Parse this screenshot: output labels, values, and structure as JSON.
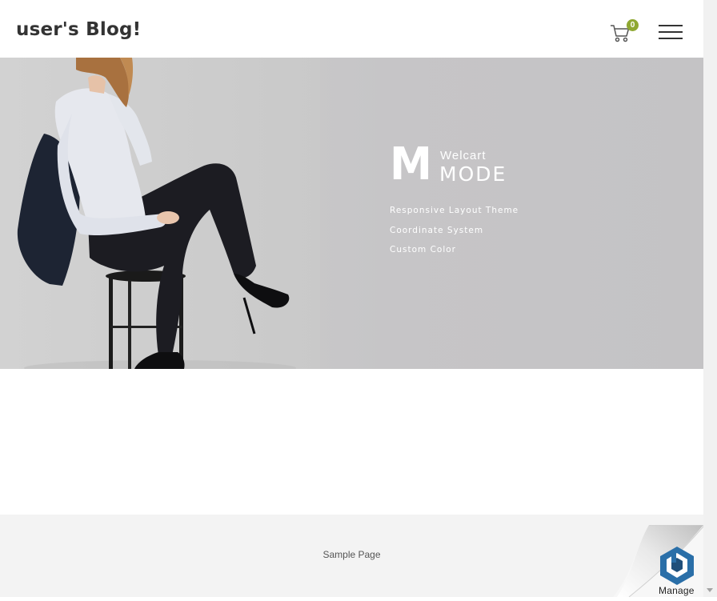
{
  "header": {
    "site_title": "user's Blog!",
    "cart_count": "0",
    "cart_icon": "cart-icon",
    "menu_icon": "hamburger-menu-icon"
  },
  "hero": {
    "brand_mark": "M",
    "brand_line1": "Welcart",
    "brand_line2": "MODE",
    "features": [
      "Responsive Layout Theme",
      "Coordinate System",
      "Custom Color"
    ]
  },
  "footer": {
    "link": "Sample Page"
  },
  "manage_widget": {
    "label": "Manage",
    "icon": "hexagon-b-logo-icon"
  },
  "colors": {
    "accent": "#8fa832",
    "text": "#333333",
    "footer_bg": "#f3f3f3",
    "logo_blue": "#2a6fa8"
  }
}
